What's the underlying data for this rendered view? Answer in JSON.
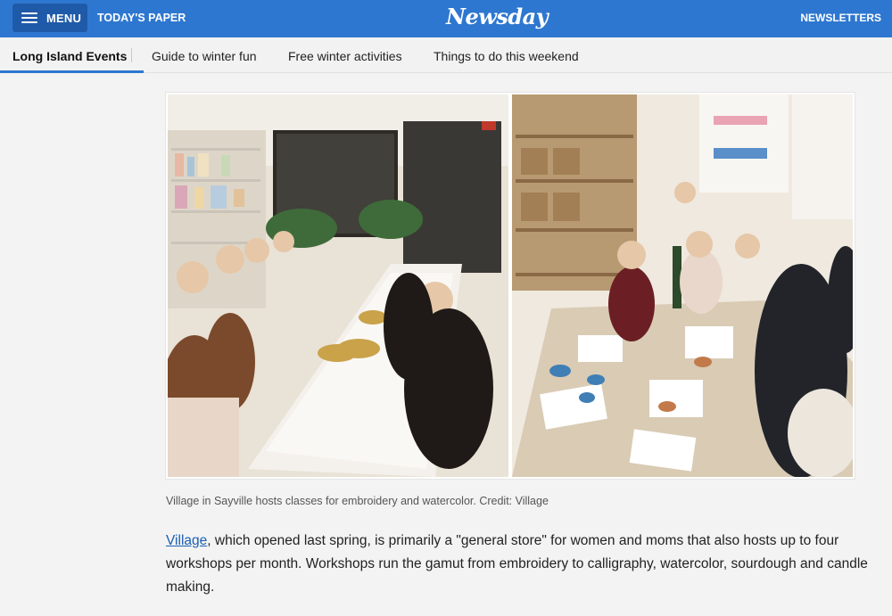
{
  "header": {
    "menu_label": "MENU",
    "todays_paper": "TODAY'S PAPER",
    "logo": "Newsday",
    "newsletters": "NEWSLETTERS",
    "icons": {
      "menu": "hamburger-icon"
    },
    "colors": {
      "bar": "#2e77d0",
      "menu_button": "#1f5aa8"
    }
  },
  "subnav": {
    "items": [
      {
        "label": "Long Island Events",
        "active": true
      },
      {
        "label": "Guide to winter fun"
      },
      {
        "label": "Free winter activities"
      },
      {
        "label": "Things to do this weekend"
      }
    ]
  },
  "article": {
    "caption": "Village in Sayville hosts classes for embroidery and watercolor. Credit: Village",
    "paragraph": {
      "link_text": "Village",
      "text": ", which opened last spring, is primarily a \"general store\" for women and moms that also hosts up to four workshops per month. Workshops run the gamut from embroidery to calligraphy, watercolor, sourdough and candle making."
    }
  }
}
